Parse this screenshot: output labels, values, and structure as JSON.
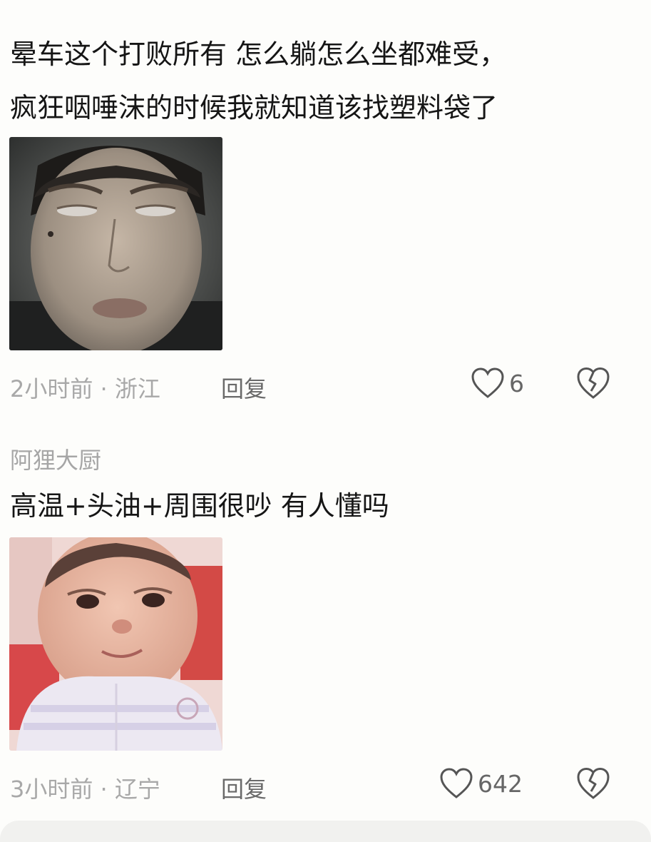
{
  "comments": [
    {
      "text_lines": [
        "晕车这个打败所有 怎么躺怎么坐都难受，",
        "疯狂咽唾沫的时候我就知道该找塑料袋了"
      ],
      "time_location": "2小时前 · 浙江",
      "reply_label": "回复",
      "like_count": "6",
      "image_icon": "photo-of-carsick-man"
    },
    {
      "username": "阿狸大厨",
      "text_lines": [
        "高温+头油+周围很吵 有人懂吗"
      ],
      "time_location": "3小时前 · 辽宁",
      "reply_label": "回复",
      "like_count": "642",
      "image_icon": "photo-of-crying-baby"
    }
  ],
  "colors": {
    "background": "#fdfdfb",
    "text": "#151515",
    "meta": "#a8a8a8",
    "icon": "#555555"
  },
  "icons": {
    "like": "heart-outline-icon",
    "dislike": "broken-heart-icon"
  }
}
